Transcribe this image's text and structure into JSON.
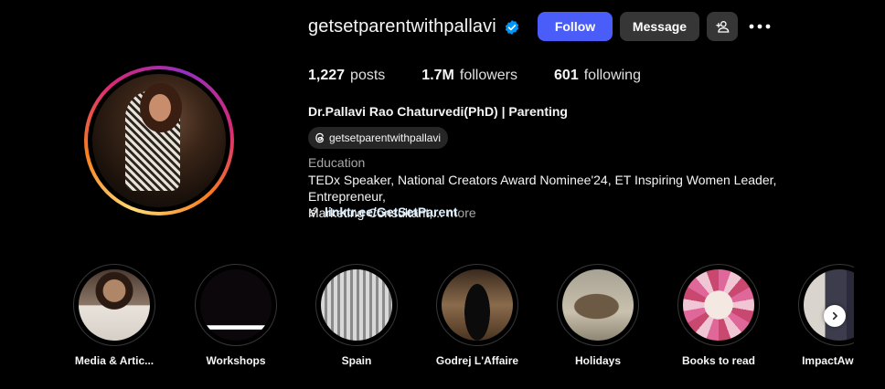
{
  "profile": {
    "username": "getsetparentwithpallavi",
    "verified": true,
    "verified_color": "#0095f6",
    "actions": {
      "follow_label": "Follow",
      "message_label": "Message",
      "add_user_icon": "person-plus-icon",
      "more_icon": "ellipsis-icon"
    },
    "stats": [
      {
        "value": "1,227",
        "label": "posts"
      },
      {
        "value": "1.7M",
        "label": "followers"
      },
      {
        "value": "601",
        "label": "following"
      }
    ],
    "full_name": "Dr.Pallavi Rao Chaturvedi(PhD) | Parenting",
    "threads_handle": "getsetparentwithpallavi",
    "category": "Education",
    "bio_line1": "TEDx Speaker, National Creators Award Nominee'24, ET Inspiring Women Leader, Entrepreneur,",
    "bio_line2": "Marketing Consultant,...",
    "bio_more": "more",
    "link": "linktr.ee/GetSetParent"
  },
  "highlights": [
    {
      "label": "Media & Artic..."
    },
    {
      "label": "Workshops"
    },
    {
      "label": "Spain"
    },
    {
      "label": "Godrej L'Affaire"
    },
    {
      "label": "Holidays"
    },
    {
      "label": "Books to read"
    },
    {
      "label": "ImpactAwards"
    }
  ],
  "colors": {
    "background": "#000000",
    "follow_button": "#4a5df9",
    "secondary_button": "#363636",
    "muted_text": "#a8a8a8"
  }
}
